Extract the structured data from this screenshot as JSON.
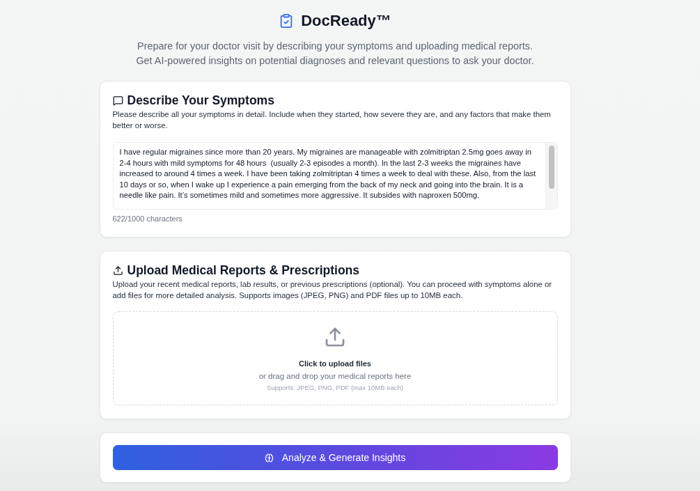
{
  "header": {
    "title": "DocReady™",
    "subtitle_lines": [
      "Prepare for your doctor visit by describing your symptoms and uploading medical reports.",
      "Get AI-powered insights on potential diagnoses and relevant questions to ask your doctor."
    ]
  },
  "symptoms": {
    "title": "Describe Your Symptoms",
    "description": "Please describe all your symptoms in detail. Include when they started, how severe they are, and any factors that make them better or worse.",
    "value": "I have regular migraines since more than 20 years. My migraines are manageable with zolmitriptan 2.5mg goes away in 2-4 hours with mild symptoms for 48 hours  (usually 2-3 episodes a month). In the last 2-3 weeks the migraines have increased to around 4 times a week. I have been taking zolmitriptan 4 times a week to deal with these. Also, from the last 10 days or so, when I wake up I experience a pain emerging from the back of my neck and going into the brain. It is a needle like pain. It’s sometimes mild and sometimes more aggressive. It subsides with naproxen 500mg.",
    "char_count": "622/1000 characters"
  },
  "upload": {
    "title": "Upload Medical Reports & Prescriptions",
    "description": "Upload your recent medical reports, lab results, or previous prescriptions (optional). You can proceed with symptoms alone or add files for more detailed analysis. Supports images (JPEG, PNG) and PDF files up to 10MB each.",
    "dropzone": {
      "title": "Click to upload files",
      "subtitle": "or drag and drop your medical reports here",
      "hint": "Supports: JPEG, PNG, PDF (max 10MB each)"
    }
  },
  "analyze_button": {
    "label": "Analyze & Generate Insights"
  }
}
